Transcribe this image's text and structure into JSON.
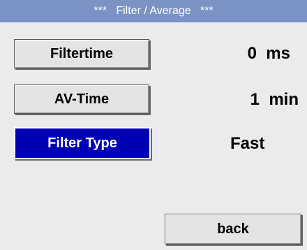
{
  "title": "***   Filter / Average   ***",
  "rows": [
    {
      "button_label": "Filtertime",
      "value": "0  ms"
    },
    {
      "button_label": "AV-Time",
      "value": "1  min"
    },
    {
      "button_label": "Filter Type",
      "value": "Fast"
    }
  ],
  "back_label": "back",
  "colors": {
    "title_bar": "#7a93c4",
    "background": "#ebebeb",
    "selected_button": "#0000b4"
  }
}
